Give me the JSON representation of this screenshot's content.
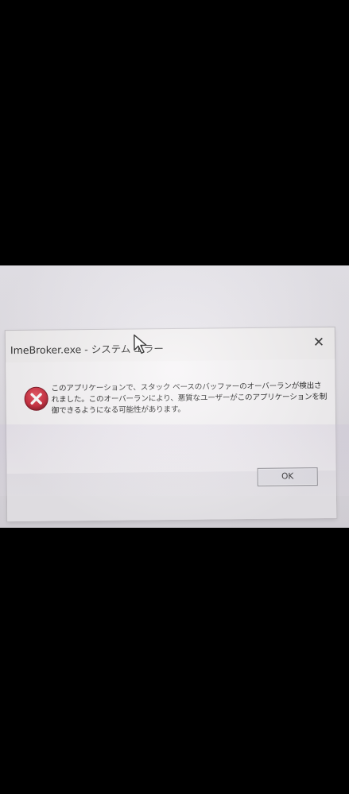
{
  "dialog": {
    "title": "ImeBroker.exe - システム エラー",
    "close_symbol": "✕",
    "message": "このアプリケーションで、スタック ベースのバッファーのオーバーランが検出されました。このオーバーランにより、悪質なユーザーがこのアプリケーションを制御できるようになる可能性があります。",
    "ok_label": "OK",
    "icon": "error-icon"
  },
  "colors": {
    "error_red": "#c8283a",
    "background_letterbox": "#000000",
    "dialog_bg": "#f3f1f2"
  }
}
